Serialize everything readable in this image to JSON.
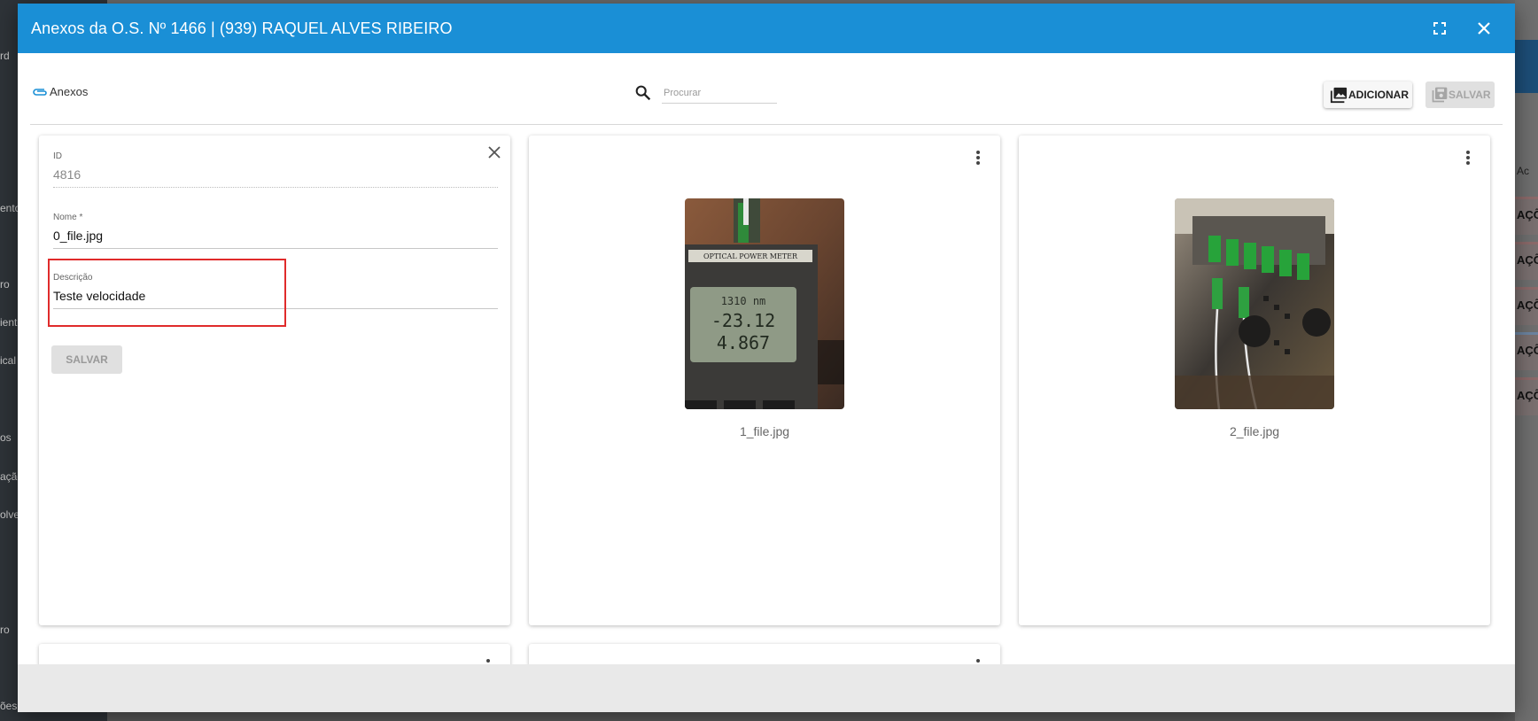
{
  "background": {
    "sidebar_labels": [
      "rd",
      "ento",
      "ro",
      "iento",
      "ical",
      "os",
      "ação",
      "olved",
      "ro",
      "ões"
    ],
    "right_rows": [
      "AÇÕ",
      "AÇÕ",
      "AÇÕ",
      "AÇÕ",
      "AÇÕ"
    ],
    "right_header": "Ac"
  },
  "modal": {
    "title": "Anexos da O.S. Nº 1466 | (939) RAQUEL ALVES RIBEIRO",
    "header_color": "#1a8fd6"
  },
  "toolbar": {
    "tab_label": "Anexos",
    "search_placeholder": "Procurar",
    "search_value": "",
    "add_label": "ADICIONAR",
    "save_label": "SALVAR"
  },
  "edit_card": {
    "id_label": "ID",
    "id_value": "4816",
    "name_label": "Nome *",
    "name_value": "0_file.jpg",
    "description_label": "Descrição",
    "description_value": "Teste velocidade",
    "save_label": "SALVAR"
  },
  "attachments": [
    {
      "file_name": "1_file.jpg",
      "photo": "optical-power-meter-photo"
    },
    {
      "file_name": "2_file.jpg",
      "photo": "fiber-connectors-photo"
    }
  ],
  "photo_text": {
    "meter_brand": "OPTICAL POWER METER",
    "meter_wavelength": "1310 nm",
    "meter_reading": "-23.12",
    "meter_reading2": "4.867"
  }
}
